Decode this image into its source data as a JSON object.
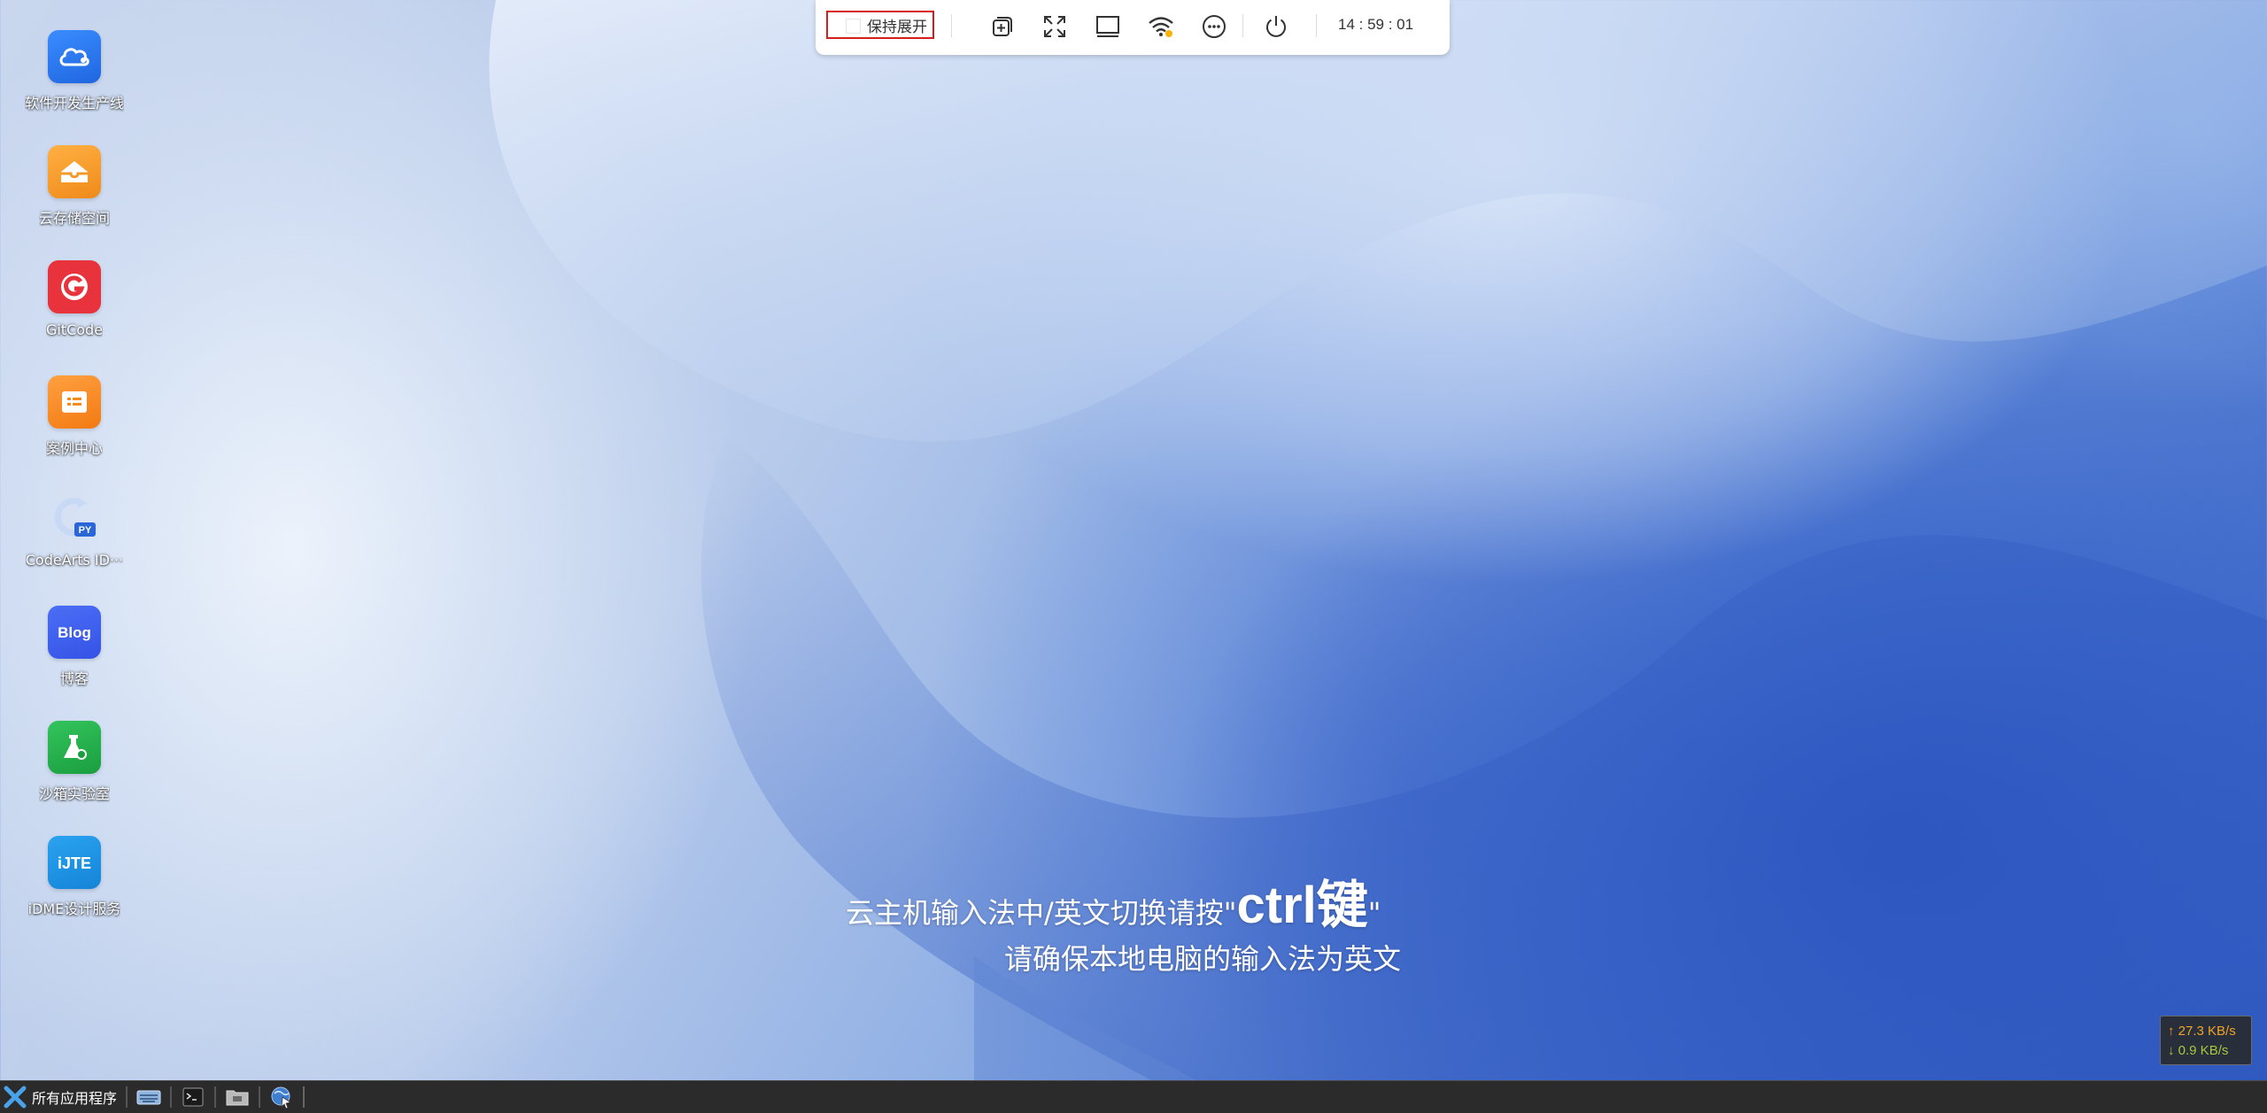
{
  "desktop": {
    "icons": [
      {
        "label": "软件开发生产线",
        "icon": "cloud-devcloud-icon",
        "color": "#2f7cf6"
      },
      {
        "label": "云存储空间",
        "icon": "cloud-storage-icon",
        "color": "#f29a2b"
      },
      {
        "label": "GitCode",
        "icon": "gitcode-logo-icon",
        "color": "#e8333d"
      },
      {
        "label": "案例中心",
        "icon": "case-center-icon",
        "color": "#f58a1f"
      },
      {
        "label": "CodeArts ID···",
        "icon": "codearts-ide-python-icon",
        "color": "#2a66d8"
      },
      {
        "label": "博客",
        "icon": "blog-icon",
        "color": "#3d5ef0"
      },
      {
        "label": "沙箱实验室",
        "icon": "sandbox-lab-icon",
        "color": "#22b14c"
      },
      {
        "label": "iDME设计服务",
        "icon": "idme-design-icon",
        "color": "#1d8fe0"
      }
    ]
  },
  "toolbar": {
    "keep_open_label": "保持展开",
    "keep_open_checked": false,
    "buttons": [
      "new-window-icon",
      "fullscreen-icon",
      "display-icon",
      "wifi-icon",
      "more-icon",
      "power-icon"
    ],
    "clock": "14 : 59 : 01"
  },
  "hint": {
    "line1_prefix": "云主机输入法中/英文切换请按\"",
    "line1_key": "ctrl键",
    "line1_suffix": "\"",
    "line2": "请确保本地电脑的输入法为英文"
  },
  "netspeed": {
    "up": "↑ 27.3 KB/s",
    "down": "↓ 0.9 KB/s"
  },
  "taskbar": {
    "start_label": "所有应用程序",
    "apps": [
      "keyboard-icon",
      "terminal-icon",
      "file-manager-icon",
      "browser-globe-icon"
    ]
  }
}
